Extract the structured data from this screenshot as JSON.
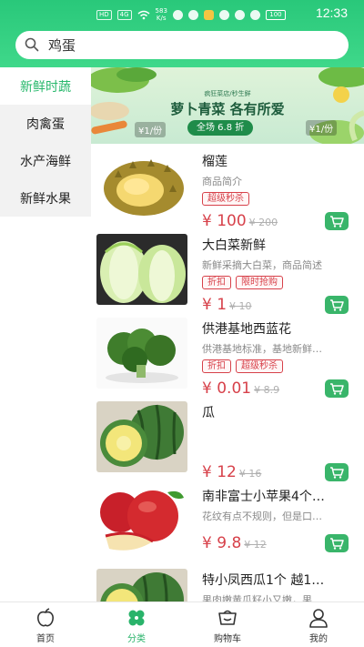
{
  "status_bar": {
    "network_tags": [
      "HD",
      "4G"
    ],
    "speed": "583\nK/s",
    "battery": "100",
    "time": "12:33"
  },
  "search": {
    "value": "鸡蛋"
  },
  "sidebar": {
    "items": [
      {
        "label": "新鲜时蔬",
        "active": true
      },
      {
        "label": "肉禽蛋",
        "active": false
      },
      {
        "label": "水产海鲜",
        "active": false
      },
      {
        "label": "新鲜水果",
        "active": false
      }
    ]
  },
  "banner": {
    "subtitle": "疯狂菜店/秒生鲜",
    "title": "萝卜青菜 各有所爱",
    "discount": "全场 6.8 折",
    "price_left": "¥1/份",
    "price_right": "¥1/份"
  },
  "products": [
    {
      "name": "榴莲",
      "desc": "商品简介",
      "tags": [
        "超级秒杀"
      ],
      "price": "¥ 100",
      "old_price": "¥ 200",
      "image": "durian"
    },
    {
      "name": "大白菜新鲜",
      "desc": "新鲜采摘大白菜，商品简述",
      "tags": [
        "折扣",
        "限时抢购"
      ],
      "price": "¥ 1",
      "old_price": "¥ 10",
      "image": "cabbage"
    },
    {
      "name": "供港基地西蓝花",
      "desc": "供港基地标准，基地新鲜…",
      "tags": [
        "折扣",
        "超级秒杀"
      ],
      "price": "¥ 0.01",
      "old_price": "¥ 8.9",
      "image": "broccoli"
    },
    {
      "name": "瓜",
      "desc": "",
      "tags": [],
      "price": "¥ 12",
      "old_price": "¥ 16",
      "image": "melon"
    },
    {
      "name": "南非富士小苹果4个…",
      "desc": "花纹有点不规则，但是口…",
      "tags": [],
      "price": "¥ 9.8",
      "old_price": "¥ 12",
      "image": "apple"
    },
    {
      "name": "特小凤西瓜1个 越1…",
      "desc": "果肉嫩黄瓜籽小又嫩，果…",
      "tags": [],
      "price": "",
      "old_price": "",
      "image": "watermelon"
    }
  ],
  "bottom_nav": [
    {
      "label": "首页",
      "icon": "home-icon",
      "active": false
    },
    {
      "label": "分类",
      "icon": "category-icon",
      "active": true
    },
    {
      "label": "购物车",
      "icon": "cart-icon",
      "active": false
    },
    {
      "label": "我的",
      "icon": "profile-icon",
      "active": false
    }
  ],
  "colors": {
    "brand_green": "#29c87a",
    "price_red": "#d7414a",
    "cart_green": "#39b56a"
  }
}
